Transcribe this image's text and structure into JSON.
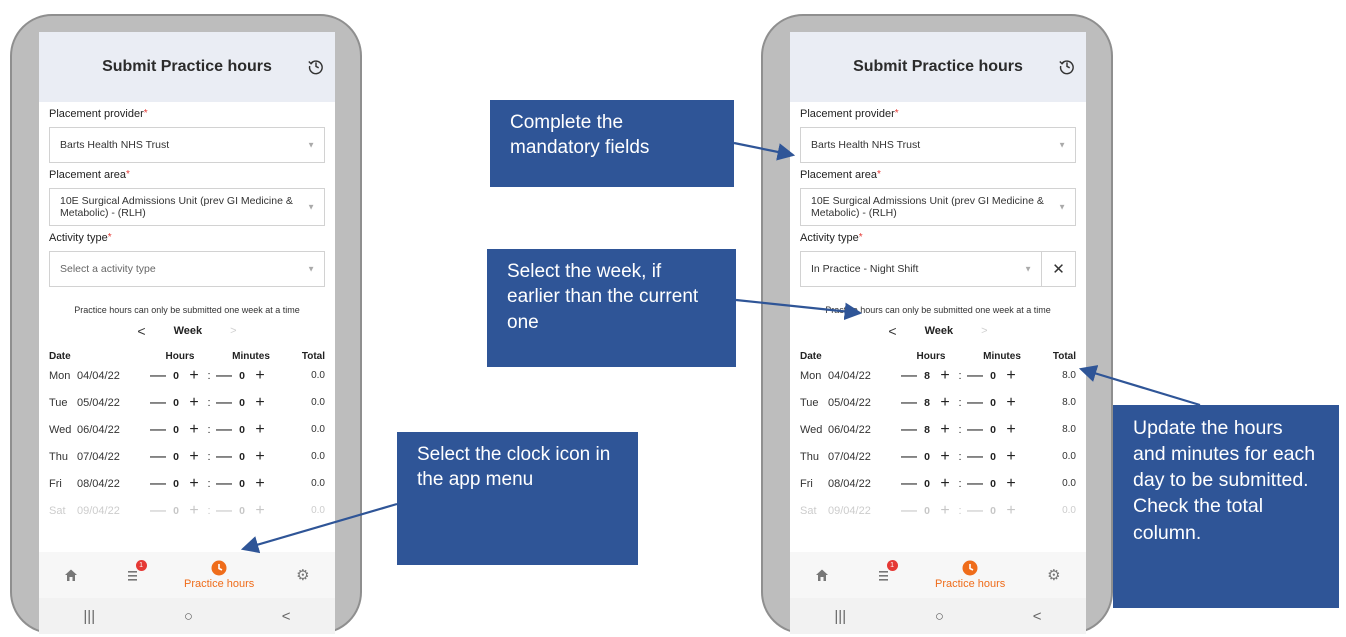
{
  "screens": [
    {
      "header": {
        "title": "Submit Practice hours",
        "history_icon": "history-icon"
      },
      "form": {
        "provider_label": "Placement provider",
        "provider_value": "Barts Health NHS Trust",
        "area_label": "Placement area",
        "area_value": "10E Surgical Admissions Unit (prev GI Medicine & Metabolic) - (RLH)",
        "activity_label": "Activity type",
        "activity_value": "Select a activity type",
        "required_mark": "*"
      },
      "info": "Practice hours can only be submitted one week at a time",
      "week": {
        "prev": "<",
        "label": "Week",
        "next": ">"
      },
      "columns": [
        "Date",
        "Hours",
        "Minutes",
        "Total"
      ],
      "days": [
        {
          "day": "Mon",
          "date": "04/04/22",
          "hours": "0",
          "minutes": "0",
          "total": "0.0"
        },
        {
          "day": "Tue",
          "date": "05/04/22",
          "hours": "0",
          "minutes": "0",
          "total": "0.0"
        },
        {
          "day": "Wed",
          "date": "06/04/22",
          "hours": "0",
          "minutes": "0",
          "total": "0.0"
        },
        {
          "day": "Thu",
          "date": "07/04/22",
          "hours": "0",
          "minutes": "0",
          "total": "0.0"
        },
        {
          "day": "Fri",
          "date": "08/04/22",
          "hours": "0",
          "minutes": "0",
          "total": "0.0"
        },
        {
          "day": "Sat",
          "date": "09/04/22",
          "hours": "0",
          "minutes": "0",
          "total": "0.0"
        }
      ],
      "nav": {
        "home_icon": "home-icon",
        "list_icon": "list-icon",
        "badge": "1",
        "active_label": "Practice hours",
        "settings_icon": "gear-icon"
      },
      "sysnav": {
        "recent": "|||",
        "home": "○",
        "back": "<"
      }
    },
    {
      "header": {
        "title": "Submit Practice hours",
        "history_icon": "history-icon"
      },
      "form": {
        "provider_label": "Placement provider",
        "provider_value": "Barts Health NHS Trust",
        "area_label": "Placement area",
        "area_value": "10E Surgical Admissions Unit (prev GI Medicine & Metabolic) - (RLH)",
        "activity_label": "Activity type",
        "activity_value": "In Practice - Night Shift",
        "required_mark": "*",
        "clear": "✕"
      },
      "info": "Practice hours can only be submitted one week at a time",
      "week": {
        "prev": "<",
        "label": "Week",
        "next": ">"
      },
      "columns": [
        "Date",
        "Hours",
        "Minutes",
        "Total"
      ],
      "days": [
        {
          "day": "Mon",
          "date": "04/04/22",
          "hours": "8",
          "minutes": "0",
          "total": "8.0"
        },
        {
          "day": "Tue",
          "date": "05/04/22",
          "hours": "8",
          "minutes": "0",
          "total": "8.0"
        },
        {
          "day": "Wed",
          "date": "06/04/22",
          "hours": "8",
          "minutes": "0",
          "total": "8.0"
        },
        {
          "day": "Thu",
          "date": "07/04/22",
          "hours": "0",
          "minutes": "0",
          "total": "0.0"
        },
        {
          "day": "Fri",
          "date": "08/04/22",
          "hours": "0",
          "minutes": "0",
          "total": "0.0"
        },
        {
          "day": "Sat",
          "date": "09/04/22",
          "hours": "0",
          "minutes": "0",
          "total": "0.0"
        }
      ],
      "nav": {
        "home_icon": "home-icon",
        "list_icon": "list-icon",
        "badge": "1",
        "active_label": "Practice hours",
        "settings_icon": "gear-icon"
      },
      "sysnav": {
        "recent": "|||",
        "home": "○",
        "back": "<"
      }
    }
  ],
  "callouts": {
    "mandatory": "Complete the mandatory fields",
    "week": "Select the week, if earlier than the current one",
    "clock": "Select the clock icon in the app menu",
    "update": "Update the hours and minutes for each day to be submitted. Check the total column."
  },
  "colors": {
    "callout_bg": "#2f5597",
    "accent": "#ef6c1a",
    "badge": "#e53935"
  },
  "controls": {
    "minus": "—",
    "plus": "+",
    "colon": ":"
  }
}
